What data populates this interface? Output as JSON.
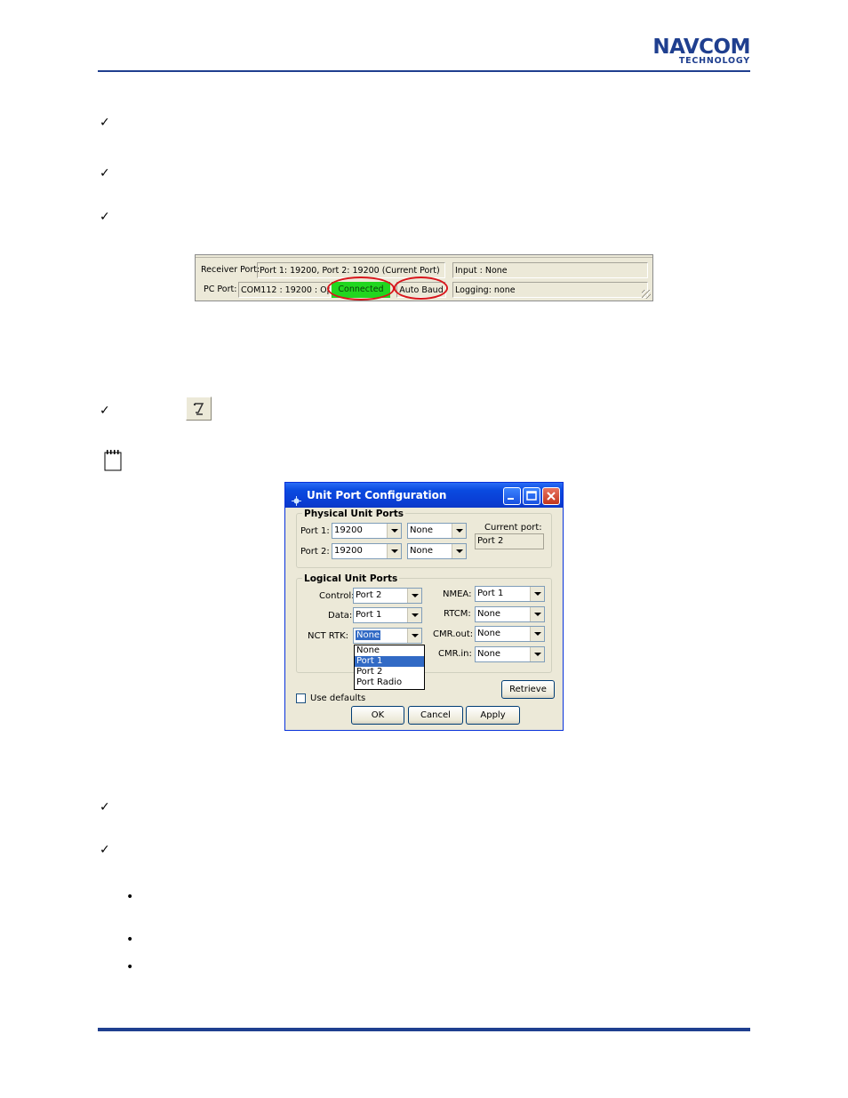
{
  "header": {
    "logo_main": "NAVCOM",
    "logo_sub": "TECHNOLOGY"
  },
  "marks": {
    "check": "✓",
    "bullet": "•"
  },
  "statusbar": {
    "receiver_label": "Receiver Port:",
    "receiver_value": "Port 1: 19200, Port 2: 19200 (Current Port)",
    "input": "Input : None",
    "pc_label": "PC Port:",
    "pc_value": "COM112 : 19200 : Open",
    "connected": "Connected",
    "auto_baud": "Auto Baud",
    "logging": "Logging: none",
    "highlight_color": "#d8161c",
    "connected_color": "#21d61f"
  },
  "dialog": {
    "title": "Unit Port Configuration",
    "physical": {
      "title": "Physical  Unit Ports",
      "port1_label": "Port 1:",
      "port1_baud": "19200",
      "port1_mode": "None",
      "port2_label": "Port 2:",
      "port2_baud": "19200",
      "port2_mode": "None",
      "current_label": "Current port:",
      "current_value": "Port 2"
    },
    "logical": {
      "title": "Logical Unit Ports",
      "control_label": "Control:",
      "control_value": "Port 2",
      "data_label": "Data:",
      "data_value": "Port 1",
      "nct_label": "NCT RTK:",
      "nct_value": "None",
      "nmea_label": "NMEA:",
      "nmea_value": "Port 1",
      "rtcm_label": "RTCM:",
      "rtcm_value": "None",
      "cmrout_label": "CMR.out:",
      "cmrout_value": "None",
      "cmrin_label": "CMR.in:",
      "cmrin_value": "None",
      "dropdown_options": [
        "None",
        "Port 1",
        "Port 2",
        "Port Radio"
      ],
      "dropdown_highlighted": "Port 1"
    },
    "retrieve": "Retrieve",
    "use_defaults": "Use defaults",
    "ok": "OK",
    "cancel": "Cancel",
    "apply": "Apply"
  }
}
